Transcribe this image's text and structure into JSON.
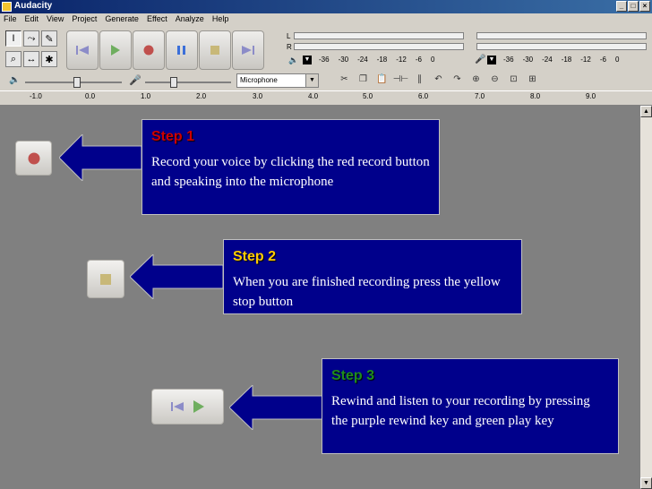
{
  "window": {
    "title": "Audacity",
    "btn_min": "_",
    "btn_max": "□",
    "btn_close": "×"
  },
  "menu": [
    "File",
    "Edit",
    "View",
    "Project",
    "Generate",
    "Effect",
    "Analyze",
    "Help"
  ],
  "meters": {
    "play_ticks": [
      "-36",
      "-30",
      "-24",
      "-18",
      "-12",
      "-6",
      "0"
    ],
    "rec_ticks": [
      "-36",
      "-30",
      "-24",
      "-18",
      "-12",
      "-6",
      "0"
    ],
    "left_label": "L",
    "right_label": "R",
    "ticks_play": [
      "18",
      "12",
      "6",
      "0"
    ],
    "ticks_rec": [
      "18",
      "12",
      "6",
      "0"
    ]
  },
  "mixer": {
    "input_source": "Microphone",
    "dropdown_arrow": "▼"
  },
  "ruler": [
    "-1.0",
    "0.0",
    "1.0",
    "2.0",
    "3.0",
    "4.0",
    "5.0",
    "6.0",
    "7.0",
    "8.0",
    "9.0"
  ],
  "steps": [
    {
      "title": "Step 1",
      "text": "Record your voice by clicking the red record button and speaking into the microphone",
      "title_color": "#cc0000"
    },
    {
      "title": "Step 2",
      "text": "When you are finished recording press the yellow stop button",
      "title_color": "#ffcc00"
    },
    {
      "title": "Step 3",
      "text": "Rewind and listen to your recording by pressing the purple rewind key and green play key",
      "title_color": "#1e8c1e"
    }
  ],
  "colors": {
    "record": "#c0504d",
    "stop": "#c8b878",
    "play": "#6fae5f",
    "pause": "#3b6fd9",
    "rewind": "#8c8cc8",
    "arrow": "#00008b"
  }
}
